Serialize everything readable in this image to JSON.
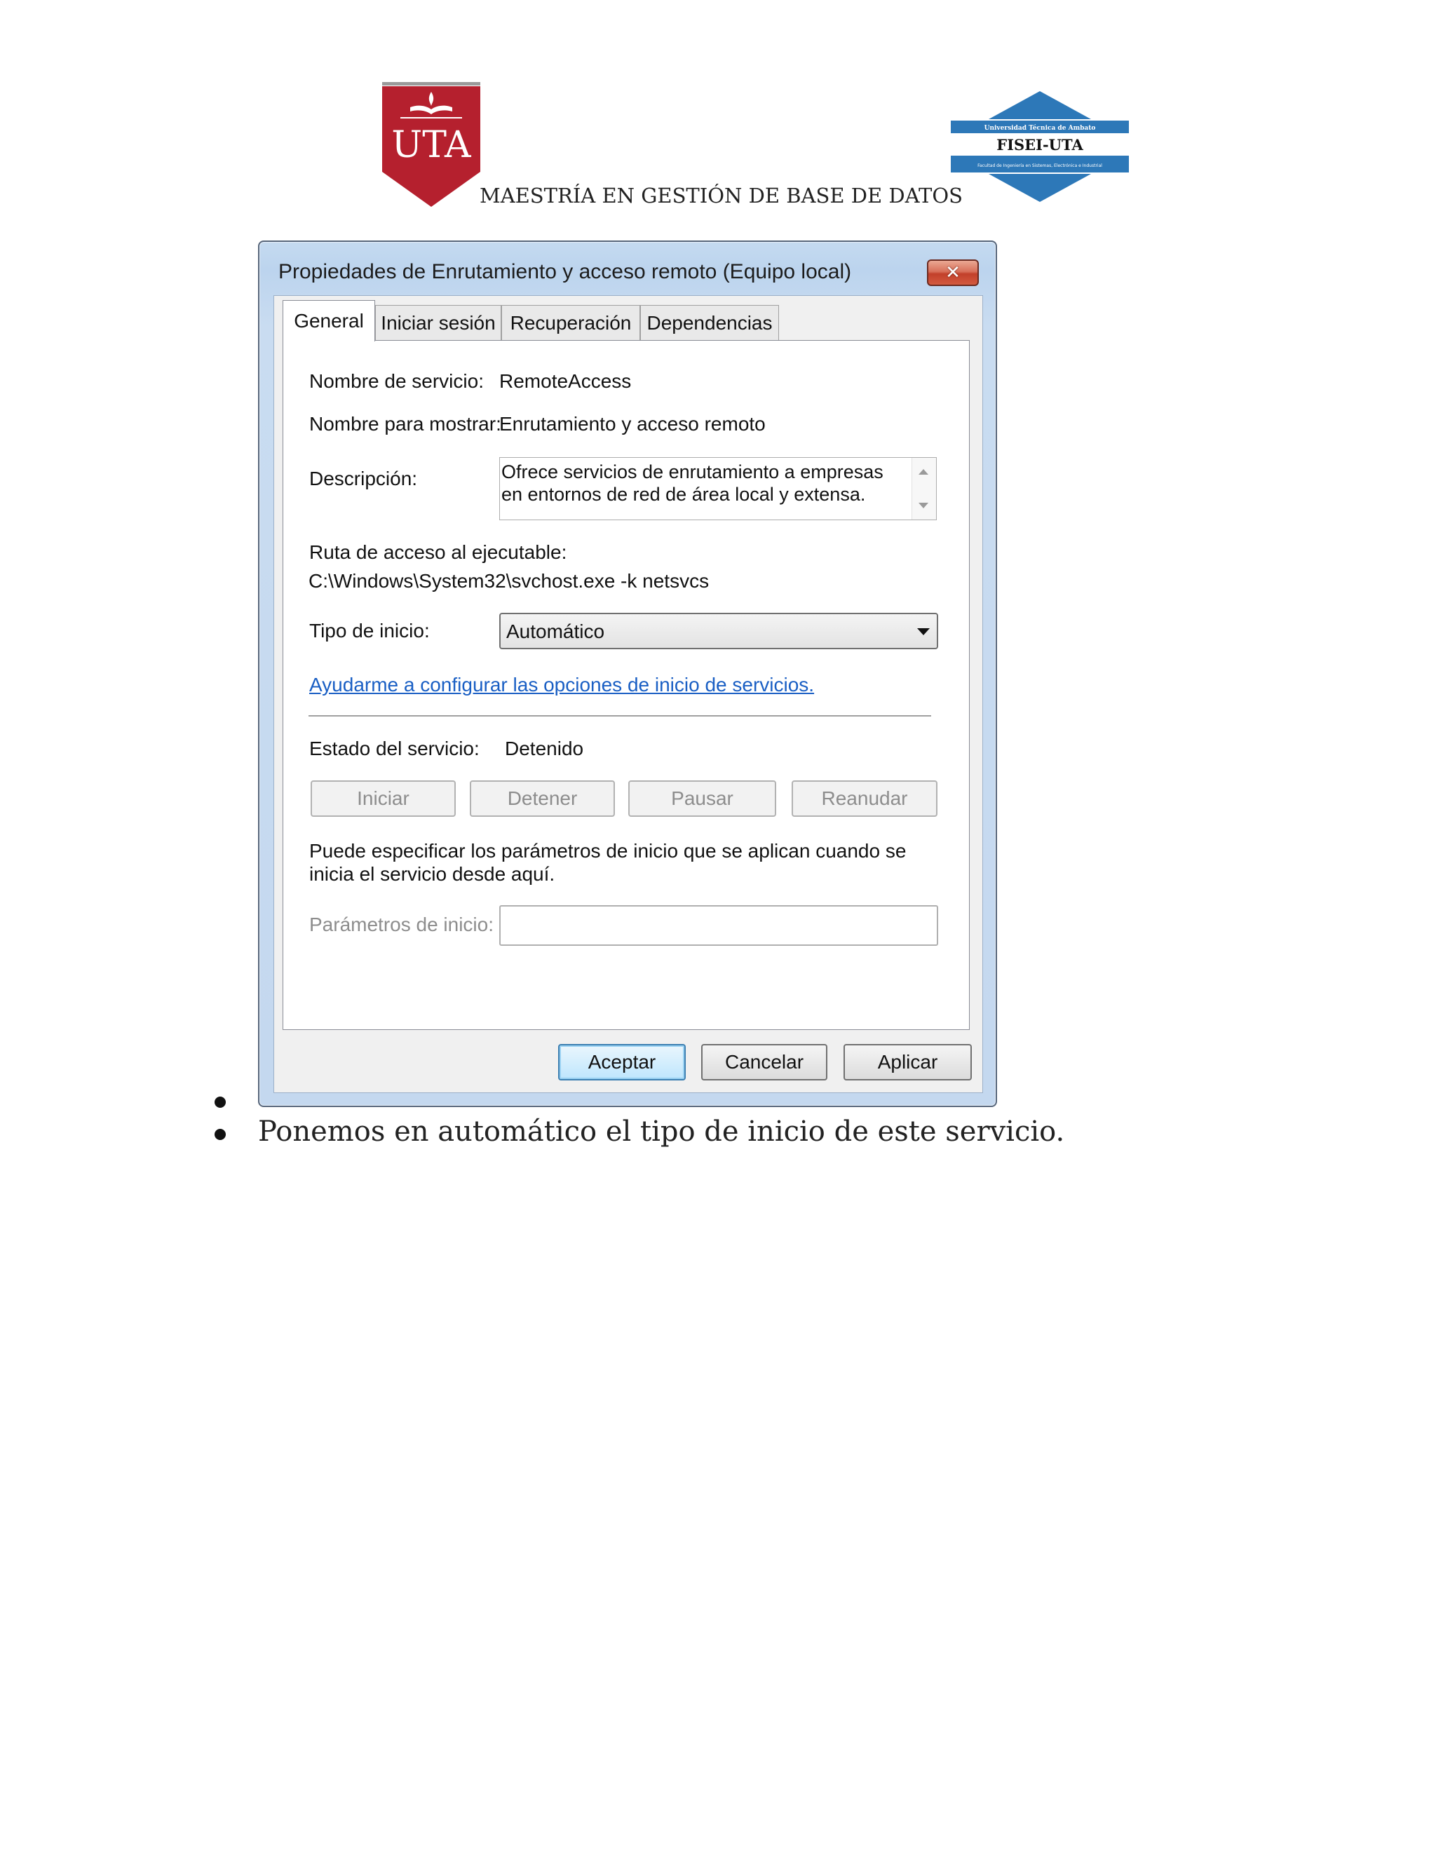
{
  "header": {
    "uta_logo_text": "UTA",
    "fisei_logo": {
      "line1": "Universidad Técnica de Ambato",
      "line2": "FISEI-UTA",
      "line3": "Facultad de Ingeniería en Sistemas, Electrónica e Industrial"
    },
    "caption": "MAESTRÍA EN GESTIÓN DE BASE DE DATOS"
  },
  "dialog": {
    "title": "Propiedades de Enrutamiento y acceso remoto (Equipo local)",
    "close_glyph": "✕",
    "tabs": [
      {
        "label": "General",
        "active": true
      },
      {
        "label": "Iniciar sesión",
        "active": false
      },
      {
        "label": "Recuperación",
        "active": false
      },
      {
        "label": "Dependencias",
        "active": false
      }
    ],
    "service_name_label": "Nombre de servicio:",
    "service_name_value": "RemoteAccess",
    "display_name_label": "Nombre para mostrar:",
    "display_name_value": "Enrutamiento y acceso remoto",
    "description_label": "Descripción:",
    "description_value": "Ofrece servicios de enrutamiento a empresas en entornos de red de área local y extensa.",
    "exe_path_label": "Ruta de acceso al ejecutable:",
    "exe_path_value": "C:\\Windows\\System32\\svchost.exe -k netsvcs",
    "startup_type_label": "Tipo de inicio:",
    "startup_type_value": "Automático",
    "help_link": "Ayudarme a configurar las opciones de inicio de servicios.",
    "status_label": "Estado del servicio:",
    "status_value": "Detenido",
    "service_buttons": [
      "Iniciar",
      "Detener",
      "Pausar",
      "Reanudar"
    ],
    "params_note": "Puede especificar los parámetros de inicio que se aplican cuando se inicia el servicio desde aquí.",
    "params_label": "Parámetros de inicio:",
    "params_value": "",
    "footer_buttons": [
      "Aceptar",
      "Cancelar",
      "Aplicar"
    ]
  },
  "bullets": [
    "",
    "Ponemos en automático el tipo de inicio de este servicio."
  ],
  "colors": {
    "uta_red": "#b5202e",
    "fisei_blue": "#2d78b8",
    "link_blue": "#1a5fc4",
    "close_red": "#c2402a"
  },
  "icons": [
    "uta-logo",
    "fisei-uta-logo",
    "close-icon",
    "scroll-up-icon",
    "scroll-down-icon",
    "dropdown-arrow-icon"
  ]
}
